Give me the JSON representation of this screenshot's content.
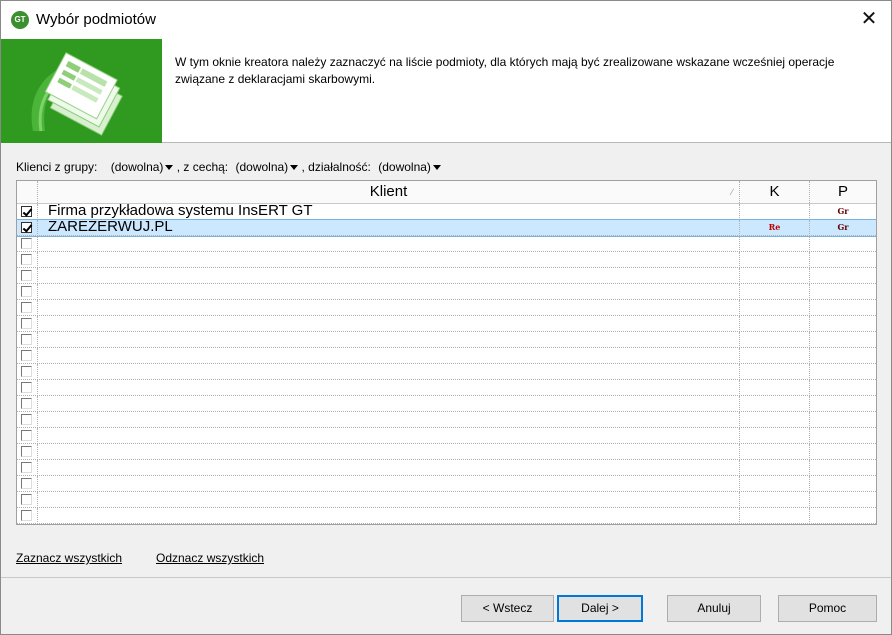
{
  "window": {
    "title": "Wybór podmiotów",
    "close_symbol": "✕",
    "app_icon_text": "GT"
  },
  "header": {
    "description": "W tym oknie kreatora należy zaznaczyć na liście podmioty, dla których mają być zrealizowane wskazane wcześniej operacje związane z deklaracjami skarbowymi.",
    "image_icon": "documents-arrow-icon"
  },
  "filters": {
    "group_label": "Klienci z grupy:",
    "group_value": "(dowolna)",
    "feature_label": ", z cechą:",
    "feature_value": "(dowolna)",
    "activity_label": ", działalność:",
    "activity_value": "(dowolna)"
  },
  "grid": {
    "columns": {
      "klient": "Klient",
      "k": "K",
      "p": "P"
    },
    "rows": [
      {
        "checked": true,
        "klient": "Firma przykładowa systemu InsERT GT",
        "k": "",
        "p": "Gr",
        "selected": false
      },
      {
        "checked": true,
        "klient": "ZAREZERWUJ.PL",
        "k": "Re",
        "p": "Gr",
        "selected": true
      },
      {
        "checked": false,
        "klient": "",
        "k": "",
        "p": ""
      },
      {
        "checked": false,
        "klient": "",
        "k": "",
        "p": ""
      },
      {
        "checked": false,
        "klient": "",
        "k": "",
        "p": ""
      },
      {
        "checked": false,
        "klient": "",
        "k": "",
        "p": ""
      },
      {
        "checked": false,
        "klient": "",
        "k": "",
        "p": ""
      },
      {
        "checked": false,
        "klient": "",
        "k": "",
        "p": ""
      },
      {
        "checked": false,
        "klient": "",
        "k": "",
        "p": ""
      },
      {
        "checked": false,
        "klient": "",
        "k": "",
        "p": ""
      },
      {
        "checked": false,
        "klient": "",
        "k": "",
        "p": ""
      },
      {
        "checked": false,
        "klient": "",
        "k": "",
        "p": ""
      },
      {
        "checked": false,
        "klient": "",
        "k": "",
        "p": ""
      },
      {
        "checked": false,
        "klient": "",
        "k": "",
        "p": ""
      },
      {
        "checked": false,
        "klient": "",
        "k": "",
        "p": ""
      },
      {
        "checked": false,
        "klient": "",
        "k": "",
        "p": ""
      },
      {
        "checked": false,
        "klient": "",
        "k": "",
        "p": ""
      },
      {
        "checked": false,
        "klient": "",
        "k": "",
        "p": ""
      },
      {
        "checked": false,
        "klient": "",
        "k": "",
        "p": ""
      },
      {
        "checked": false,
        "klient": "",
        "k": "",
        "p": ""
      }
    ]
  },
  "links": {
    "select_all": "Zaznacz wszystkich",
    "deselect_all": "Odznacz wszystkich"
  },
  "buttons": {
    "back": "< Wstecz",
    "next": "Dalej >",
    "cancel": "Anuluj",
    "help": "Pomoc"
  },
  "colors": {
    "banner_green": "#2f9a1f",
    "selection": "#cce8ff",
    "tag_re": "#c00000",
    "tag_gr": "#600000"
  }
}
